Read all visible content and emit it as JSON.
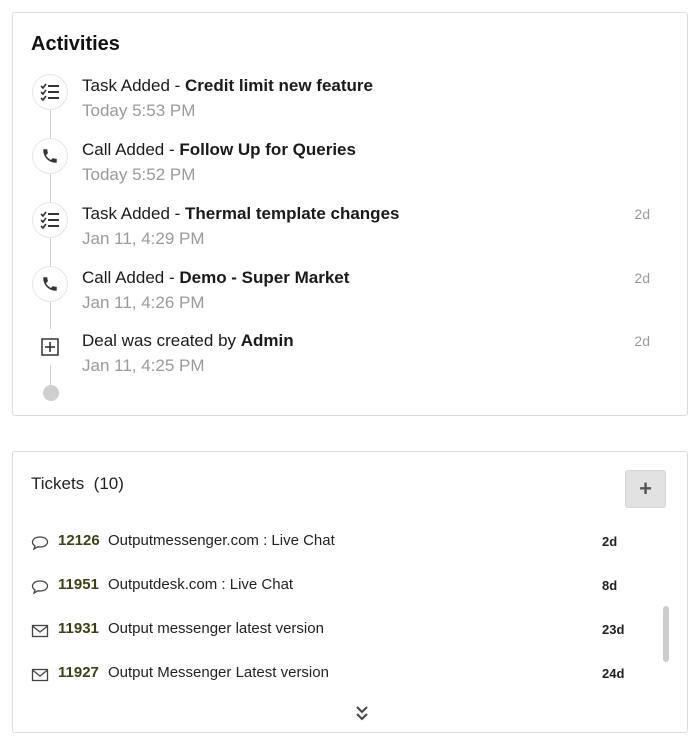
{
  "activities": {
    "title": "Activities",
    "items": [
      {
        "icon": "task-list-icon",
        "action": "Task Added - ",
        "subject": "Credit limit new feature",
        "time": "Today 5:53 PM",
        "age": ""
      },
      {
        "icon": "phone-icon",
        "action": "Call Added - ",
        "subject": "Follow Up for Queries",
        "time": "Today 5:52 PM",
        "age": ""
      },
      {
        "icon": "task-list-icon",
        "action": "Task Added - ",
        "subject": "Thermal template changes",
        "time": "Jan 11, 4:29 PM",
        "age": "2d"
      },
      {
        "icon": "phone-icon",
        "action": "Call Added - ",
        "subject": "Demo - Super Market",
        "time": "Jan 11, 4:26 PM",
        "age": "2d"
      },
      {
        "icon": "plus-box-icon",
        "action": "Deal was created by ",
        "subject": "Admin",
        "time": "Jan 11, 4:25 PM",
        "age": "2d"
      }
    ]
  },
  "tickets": {
    "title": "Tickets",
    "count": "(10)",
    "add_label": "+",
    "rows": [
      {
        "icon": "chat-bubble-icon",
        "id": "12126",
        "subject": "Outputmessenger.com : Live Chat",
        "age": "2d"
      },
      {
        "icon": "chat-bubble-icon",
        "id": "11951",
        "subject": "Outputdesk.com : Live Chat",
        "age": "8d"
      },
      {
        "icon": "envelope-icon",
        "id": "11931",
        "subject": "Output messenger latest version",
        "age": "23d"
      },
      {
        "icon": "envelope-icon",
        "id": "11927",
        "subject": "Output Messenger Latest version",
        "age": "24d"
      }
    ]
  }
}
